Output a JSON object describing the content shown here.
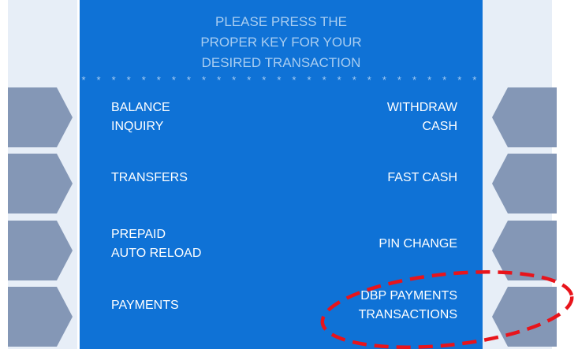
{
  "screen": {
    "heading_lines": [
      "PLEASE PRESS THE",
      "PROPER KEY FOR YOUR",
      "DESIRED TRANSACTION"
    ],
    "divider": "* * * * * * * * * * * * * * * * * * * * * * * * * * *"
  },
  "options": {
    "left": [
      {
        "lines": [
          "BALANCE",
          "INQUIRY"
        ]
      },
      {
        "lines": [
          "TRANSFERS"
        ]
      },
      {
        "lines": [
          "PREPAID",
          "AUTO RELOAD"
        ]
      },
      {
        "lines": [
          "PAYMENTS"
        ]
      }
    ],
    "right": [
      {
        "lines": [
          "WITHDRAW",
          "CASH"
        ]
      },
      {
        "lines": [
          "FAST CASH"
        ]
      },
      {
        "lines": [
          "PIN CHANGE"
        ]
      },
      {
        "lines": [
          "DBP PAYMENTS",
          "TRANSACTIONS"
        ]
      }
    ]
  },
  "colors": {
    "screen_background": "#0f72d6",
    "heading_text": "#a8cdf1",
    "option_text": "#ffffff",
    "function_key": "#8497b6",
    "side_panel": "#e7eef7",
    "highlight_ellipse": "#e8141b"
  },
  "annotation": {
    "type": "dashed-ellipse",
    "highlights": "DBP PAYMENTS TRANSACTIONS"
  }
}
